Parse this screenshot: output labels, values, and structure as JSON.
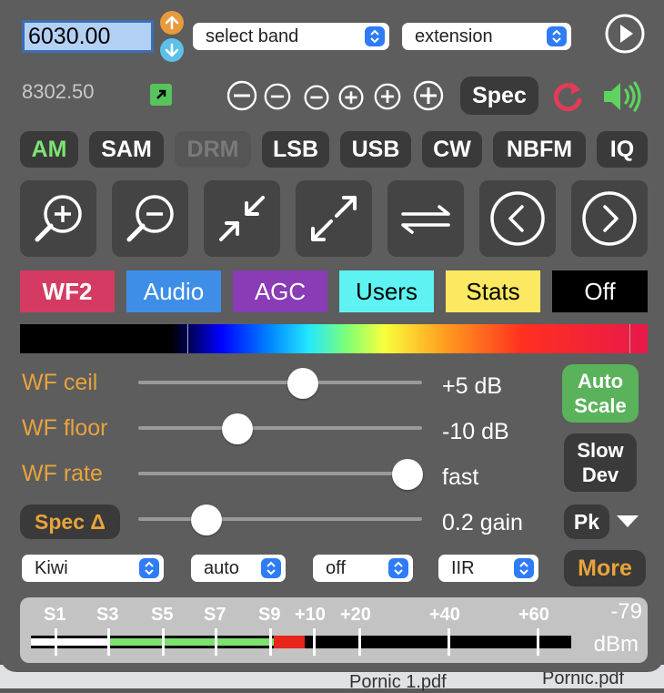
{
  "frequency": {
    "value": "6030.00",
    "secondary": "8302.50"
  },
  "band_select": {
    "selected": "select band"
  },
  "extension_select": {
    "selected": "extension"
  },
  "spec_button": {
    "label": "Spec"
  },
  "modes": [
    {
      "label": "AM",
      "state": "active"
    },
    {
      "label": "SAM",
      "state": "normal"
    },
    {
      "label": "DRM",
      "state": "disabled"
    },
    {
      "label": "LSB",
      "state": "normal"
    },
    {
      "label": "USB",
      "state": "normal"
    },
    {
      "label": "CW",
      "state": "normal"
    },
    {
      "label": "NBFM",
      "state": "normal"
    },
    {
      "label": "IQ",
      "state": "normal"
    }
  ],
  "zoom_buttons": [
    "zoom-in-icon",
    "zoom-out-icon",
    "zoom-min-icon",
    "zoom-max-icon",
    "swap-icon",
    "pan-left-icon",
    "pan-right-icon"
  ],
  "tabs": [
    {
      "label": "WF2",
      "bg": "#d53b62",
      "fg": "#ffffff"
    },
    {
      "label": "Audio",
      "bg": "#3e8ee8",
      "fg": "#ffffff"
    },
    {
      "label": "AGC",
      "bg": "#8a3bb6",
      "fg": "#ffffff"
    },
    {
      "label": "Users",
      "bg": "#5ef2f2",
      "fg": "#000000"
    },
    {
      "label": "Stats",
      "bg": "#fce861",
      "fg": "#000000"
    },
    {
      "label": "Off",
      "bg": "#000000",
      "fg": "#ffffff"
    }
  ],
  "sliders": {
    "wf_ceil": {
      "label": "WF ceil",
      "value": "+5 dB",
      "position": 0.58
    },
    "wf_floor": {
      "label": "WF floor",
      "value": "-10 dB",
      "position": 0.35
    },
    "wf_rate": {
      "label": "WF rate",
      "value": "fast",
      "position": 0.95
    },
    "spec_delta": {
      "label": "Spec Δ",
      "value": "0.2 gain",
      "position": 0.24
    }
  },
  "auto_scale": {
    "line1": "Auto",
    "line2": "Scale"
  },
  "slow_dev": {
    "line1": "Slow",
    "line2": "Dev"
  },
  "pk_label": "Pk",
  "bottom_selects": {
    "source": "Kiwi",
    "mode": "auto",
    "filter": "off",
    "type": "IIR"
  },
  "more_button": "More",
  "smeter": {
    "labels": [
      "S1",
      "S3",
      "S5",
      "S7",
      "S9",
      "+10",
      "+20",
      "+40",
      "+60"
    ],
    "value_dbm": "-79",
    "unit": "dBm",
    "level_fraction": 0.45,
    "peak_fraction": 0.05
  },
  "bottom_files": {
    "left": "Pornic 1.pdf",
    "right": "Pornic.pdf"
  },
  "colors": {
    "accent_orange": "#e8a33c",
    "active_green": "#7de372",
    "panel_bg": "#5d5d5d"
  }
}
